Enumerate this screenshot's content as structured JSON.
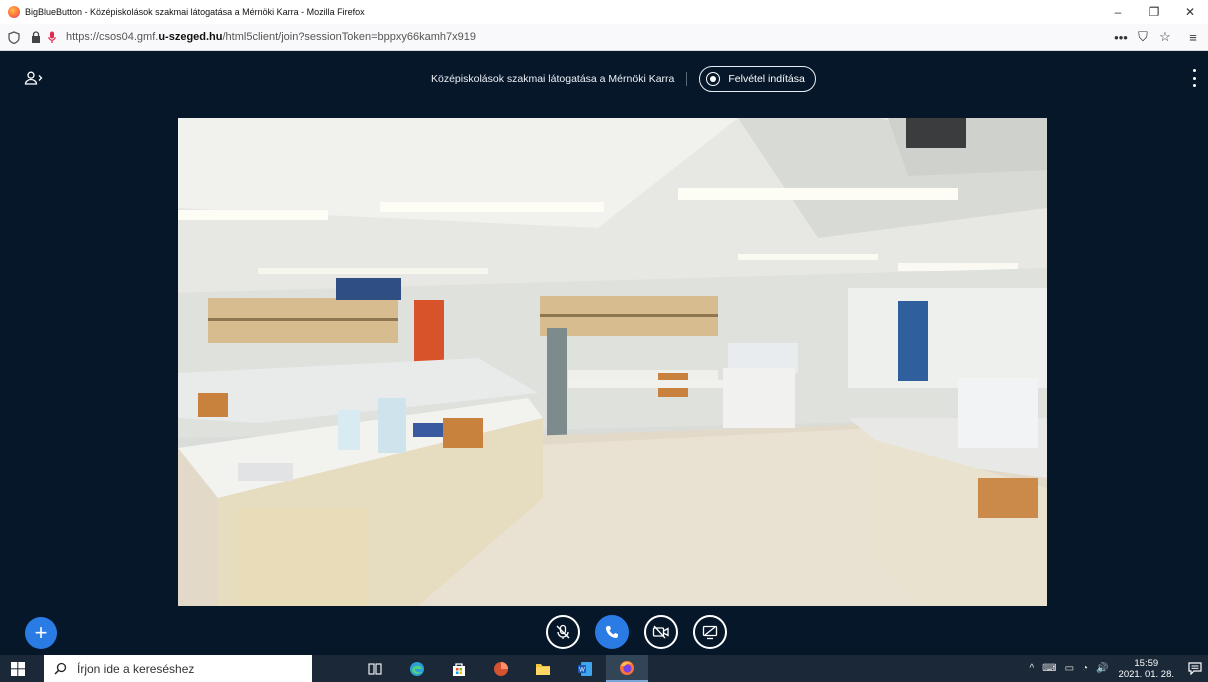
{
  "browser": {
    "window_title": "BigBlueButton - Középiskolások szakmai látogatása a Mérnöki Karra - Mozilla Firefox",
    "url_prefix": "https://csos04.gmf.",
    "url_host": "u-szeged.hu",
    "url_path": "/html5client/join?sessionToken=bppxy66kamh7x919",
    "controls": {
      "minimize": "–",
      "restore": "❐",
      "close": "✕"
    },
    "toolbar": {
      "more": "•••",
      "pocket": "⛉",
      "bookmark": "☆",
      "menu": "≡"
    }
  },
  "meeting": {
    "title": "Középiskolások szakmai látogatása a Mérnöki Karra",
    "record_label": "Felvétel indítása"
  },
  "actions_bar": {
    "plus": "+",
    "buttons": [
      "mute",
      "phone",
      "camera",
      "screenshare"
    ]
  },
  "taskbar": {
    "search_placeholder": "Írjon ide a kereséshez",
    "time": "15:59",
    "date": "2021. 01. 28.",
    "tray_icons": [
      "^",
      "⌨",
      "▭",
      "◔",
      "🔊"
    ]
  },
  "colors": {
    "app_bg": "#06172a",
    "accent": "#2a7be4",
    "taskbar": "#1b2838"
  }
}
